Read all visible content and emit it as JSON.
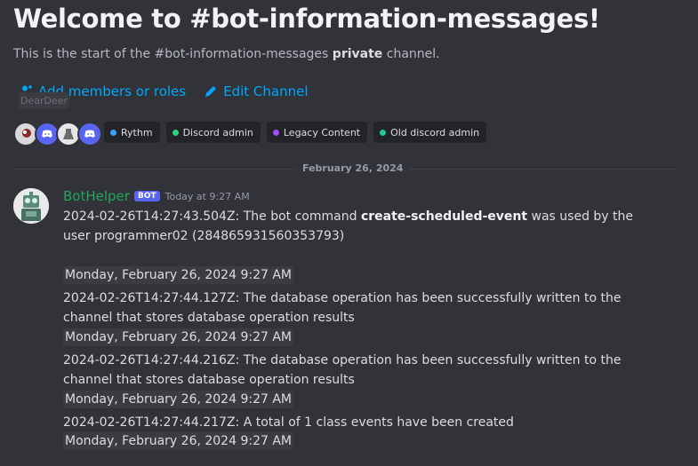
{
  "channel": {
    "welcome_title": "Welcome to #bot-information-messages!",
    "subtitle_prefix": "This is the start of the #bot-information-messages ",
    "subtitle_bold": "private",
    "subtitle_suffix": " channel.",
    "add_members_label": "Add members or roles",
    "edit_channel_label": "Edit Channel",
    "ghost_tooltip": "DearDeer"
  },
  "members": [
    {
      "icon": "user-avatar",
      "color": "#d9d9d9"
    },
    {
      "icon": "discord-icon",
      "color": "#5865f2"
    },
    {
      "icon": "user-avatar",
      "color": "#e6e6e6"
    },
    {
      "icon": "discord-icon",
      "color": "#5865f2"
    }
  ],
  "roles": [
    {
      "label": "Rythm",
      "color": "#3ba1f5"
    },
    {
      "label": "Discord admin",
      "color": "#2dd47c"
    },
    {
      "label": "Legacy Content",
      "color": "#a24ff0"
    },
    {
      "label": "Old discord admin",
      "color": "#1fc995"
    }
  ],
  "date_divider": "February 26, 2024",
  "message": {
    "username": "BotHelper",
    "bot_tag": "BOT",
    "timestamp": "Today at 9:27 AM",
    "lines": [
      {
        "pre": "2024-02-26T14:27:43.504Z: The bot command ",
        "bold": "create-scheduled-event",
        "post": " was used by the user programmer02 (284865931560353793)"
      },
      {
        "text": "2024-02-26T14:27:44.127Z: The database operation has been successfully written to the channel that stores database operation results"
      },
      {
        "text": "2024-02-26T14:27:44.216Z: The database operation has been successfully written to the channel that stores database operation results"
      },
      {
        "text": "2024-02-26T14:27:44.217Z: A total of 1 class events have been created"
      }
    ],
    "chips": [
      "Monday, February 26, 2024 9:27 AM",
      "Monday, February 26, 2024 9:27 AM",
      "Monday, February 26, 2024 9:27 AM",
      "Monday, February 26, 2024 9:27 AM"
    ]
  }
}
